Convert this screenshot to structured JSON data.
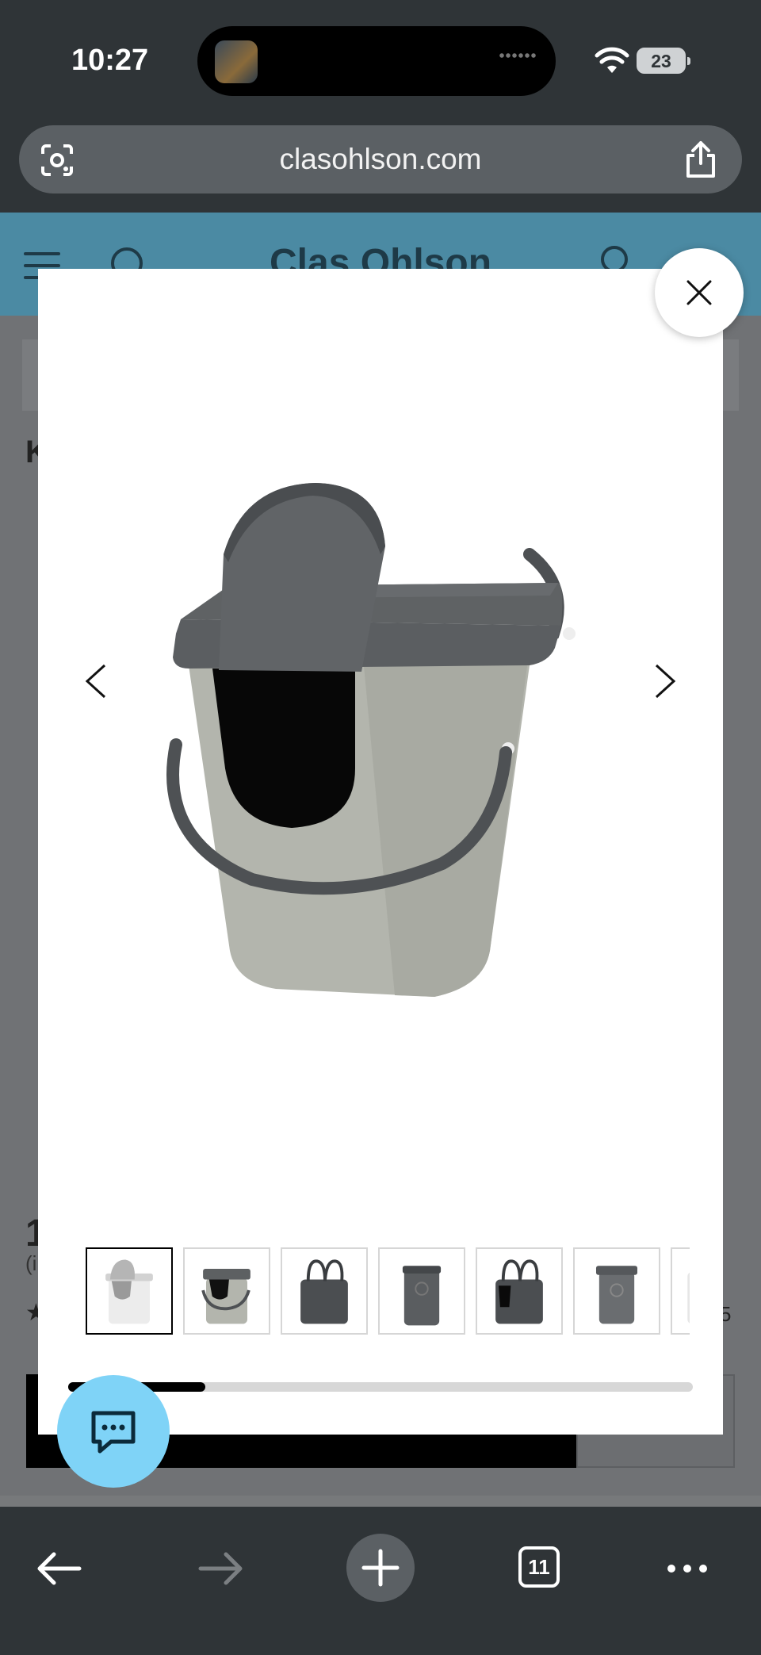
{
  "status_bar": {
    "time": "10:27",
    "battery": "23"
  },
  "browser": {
    "url": "clasohlson.com",
    "tabs_count": "11"
  },
  "site": {
    "brand": "Clas Ohlson",
    "partial_heading": "K",
    "partial_price": "1",
    "partial_sub": "(i",
    "partial_rating_count": "5"
  },
  "gallery": {
    "thumbnail_count": 7,
    "active_thumbnail": 1,
    "scroll_position": 0.22
  },
  "colors": {
    "header": "#4b8aa3",
    "chat_button": "#7fd3f7",
    "toolbar": "#2f3437",
    "bin_body": "#b7b9b1",
    "bin_lid": "#5d6062"
  },
  "icons": {
    "close": "close-icon",
    "prev": "chevron-left-icon",
    "next": "chevron-right-icon",
    "chat": "chat-bubble-icon"
  }
}
